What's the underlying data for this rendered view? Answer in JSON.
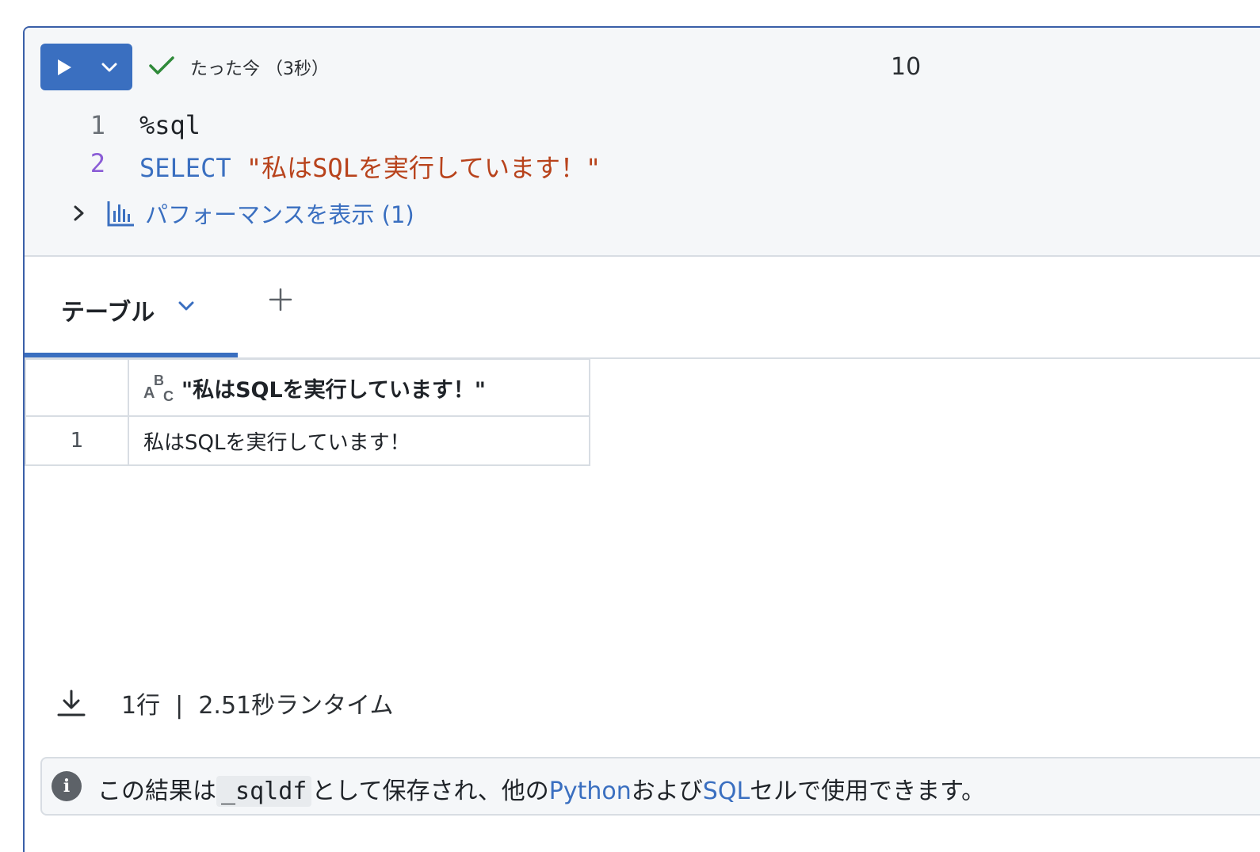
{
  "cell": {
    "status": "たった今 （3秒）",
    "exec_count": "10",
    "code_lines": [
      {
        "num": "1",
        "text": "%sql"
      },
      {
        "num": "2",
        "kw": "SELECT",
        "str": "\"私はSQLを実行しています！\""
      }
    ],
    "performance_label": "パフォーマンスを表示 (1)"
  },
  "results": {
    "tab_label": "テーブル",
    "columns": [
      "\"私はSQLを実行しています！\""
    ],
    "rows": [
      {
        "num": "1",
        "values": [
          "私はSQLを実行しています！"
        ]
      }
    ],
    "footer": "1行  |  2.51秒ランタイム"
  },
  "info": {
    "prefix": "この結果は",
    "code": "_sqldf",
    "middle": "として保存され、他の",
    "link1": "Python",
    "conj": "および",
    "link2": "SQL",
    "suffix": "セルで使用できます。"
  },
  "colors": {
    "accent": "#3a6fc0",
    "success": "#2f8a3a",
    "string": "#b8431c",
    "active_line": "#8a5cd6"
  }
}
